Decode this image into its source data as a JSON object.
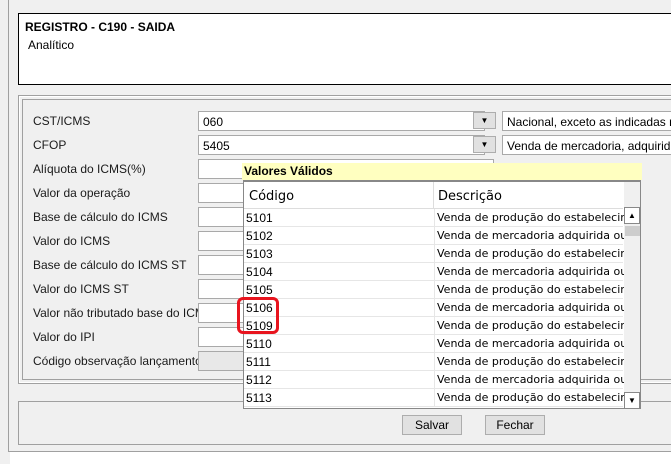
{
  "header": {
    "title": "REGISTRO - C190 - SAIDA",
    "subtitle": "Analítico"
  },
  "form": {
    "fields": [
      {
        "label": "CST/ICMS",
        "value": "060",
        "description": "Nacional, exceto as indicadas nos c"
      },
      {
        "label": "CFOP",
        "value": "5405",
        "description": "Venda de mercadoria, adquirida ou"
      },
      {
        "label": "Alíquota do ICMS(%)",
        "value": ""
      },
      {
        "label": "Valor da operação",
        "value": ""
      },
      {
        "label": "Base de cálculo do ICMS",
        "value": ""
      },
      {
        "label": "Valor do ICMS",
        "value": ""
      },
      {
        "label": "Base de cálculo do ICMS ST",
        "value": ""
      },
      {
        "label": "Valor do ICMS ST",
        "value": ""
      },
      {
        "label": "Valor não tributado base do ICMS",
        "value": ""
      },
      {
        "label": "Valor do IPI",
        "value": ""
      },
      {
        "label": "Código observação lançamento",
        "value": ""
      }
    ]
  },
  "popup": {
    "title": "Valores Válidos",
    "columns": [
      "Código",
      "Descrição"
    ],
    "rows": [
      [
        "5101",
        "Venda de produção do estabelecime..."
      ],
      [
        "5102",
        "Venda de mercadoria adquirida ou r..."
      ],
      [
        "5103",
        "Venda de produção do estabelecime..."
      ],
      [
        "5104",
        "Venda de mercadoria adquirida ou r..."
      ],
      [
        "5105",
        "Venda de produção do estabelecime..."
      ],
      [
        "5106",
        "Venda de mercadoria adquirida ou r..."
      ],
      [
        "5109",
        "Venda de produção do estabelecime..."
      ],
      [
        "5110",
        "Venda de mercadoria adquirida ou r..."
      ],
      [
        "5111",
        "Venda de produção do estabelecime..."
      ],
      [
        "5112",
        "Venda de mercadoria adquirida ou r..."
      ],
      [
        "5113",
        "Venda de produção do estabelecime..."
      ]
    ],
    "highlighted_codes": [
      "5106",
      "5109"
    ],
    "highlight_color": "#e8141e"
  },
  "buttons": {
    "save": "Salvar",
    "close": "Fechar"
  },
  "icons": {
    "dropdown": "triangle-down-icon",
    "scroll_up": "triangle-up-icon",
    "scroll_down": "triangle-down-icon"
  }
}
